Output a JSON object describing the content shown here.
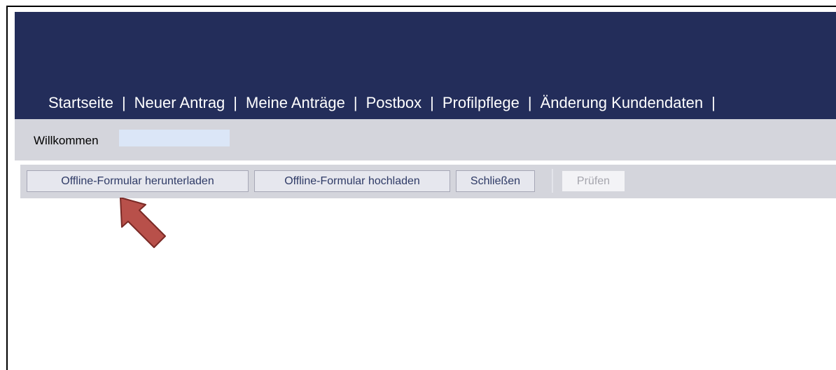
{
  "nav": {
    "items": [
      {
        "label": "Startseite"
      },
      {
        "label": "Neuer Antrag"
      },
      {
        "label": "Meine Anträge"
      },
      {
        "label": "Postbox"
      },
      {
        "label": "Profilpflege"
      },
      {
        "label": "Änderung Kundendaten"
      }
    ],
    "separator": "|"
  },
  "welcome": {
    "label": "Willkommen"
  },
  "toolbar": {
    "download_label": "Offline-Formular herunterladen",
    "upload_label": "Offline-Formular hochladen",
    "close_label": "Schließen",
    "check_label": "Prüfen"
  },
  "colors": {
    "header_bg": "#232d5a",
    "bar_bg": "#d4d5dc",
    "button_text": "#2e3a66",
    "annotation_arrow": "#b8504a"
  },
  "icons": {
    "annotation": "arrow-up-left-icon"
  }
}
